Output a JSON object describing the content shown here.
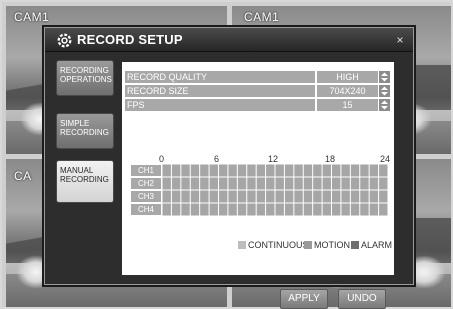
{
  "cameras": [
    "CAM1",
    "CAM1",
    "CA"
  ],
  "dialog": {
    "title": "RECORD SETUP",
    "close_glyph": "×",
    "title_icon": "settings-gear-icon"
  },
  "menu": [
    {
      "line1": "RECORDING",
      "line2": "OPERATIONS",
      "active": false
    },
    {
      "line1": "SIMPLE",
      "line2": "RECORDING",
      "active": false
    },
    {
      "line1": "MANUAL",
      "line2": "RECORDING",
      "active": true
    }
  ],
  "settings": {
    "quality": {
      "label": "RECORD QUALITY",
      "value": "HIGH"
    },
    "size": {
      "label": "RECORD SIZE",
      "value": "704X240"
    },
    "fps": {
      "label": "FPS",
      "value": "15"
    }
  },
  "schedule": {
    "hours": [
      "0",
      "6",
      "12",
      "18",
      "24"
    ],
    "channels": [
      "CH1",
      "CH2",
      "CH3",
      "CH4"
    ],
    "cell_columns": 24
  },
  "legend": [
    {
      "label": "CONTINUOUS",
      "color": "#bdbdbd"
    },
    {
      "label": "MOTION",
      "color": "#9a9a9a"
    },
    {
      "label": "ALARM",
      "color": "#6e6e6e"
    }
  ],
  "buttons": {
    "apply": "APPLY",
    "undo": "UNDO"
  },
  "colors": {
    "grid_cell": "#a6a6a6",
    "grid_line": "#ffffff"
  }
}
